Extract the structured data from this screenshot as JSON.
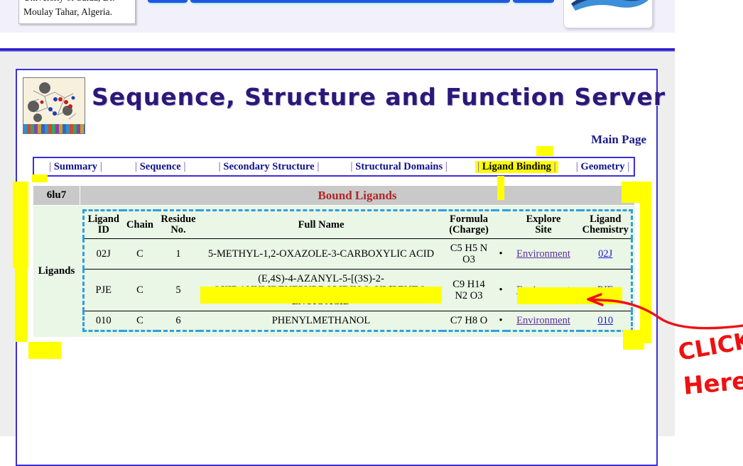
{
  "top_banner": {
    "affiliation": "University of Saida, Dr.\nMoulay Tahar, Algeria.",
    "logo_name": "institution-logo"
  },
  "header": {
    "site_title": "Sequence, Structure and Function Server",
    "main_page_label": "Main Page",
    "logo_alt": "molecular-structure-thumbnail"
  },
  "nav": {
    "items": [
      {
        "label": "Summary",
        "active": false
      },
      {
        "label": "Sequence",
        "active": false
      },
      {
        "label": "Secondary Structure",
        "active": false
      },
      {
        "label": "Structural Domains",
        "active": false
      },
      {
        "label": "Ligand Binding",
        "active": true
      },
      {
        "label": "Geometry",
        "active": false
      }
    ],
    "separator": "|"
  },
  "table": {
    "pdb_id": "6lu7",
    "section_title": "Bound Ligands",
    "row_label": "Ligands",
    "columns": [
      "Ligand ID",
      "Chain",
      "Residue No.",
      "Full Name",
      "Formula (Charge)",
      "Explore Site",
      "Ligand Chemistry"
    ],
    "columns_split": {
      "ligand_id": [
        "Ligand",
        "ID"
      ],
      "chain": [
        "Chain",
        ""
      ],
      "residue_no": [
        "Residue",
        "No."
      ],
      "full_name": [
        "Full Name",
        ""
      ],
      "formula": [
        "Formula",
        "(Charge)"
      ],
      "explore": [
        "Explore",
        "Site"
      ],
      "chemistry": [
        "Ligand",
        "Chemistry"
      ]
    },
    "rows": [
      {
        "ligand_id": "02J",
        "chain": "C",
        "residue_no": "1",
        "full_name": "5-METHYL-1,2-OXAZOLE-3-CARBOXYLIC ACID",
        "formula_line1": "C5 H5 N",
        "formula_line2": "O3",
        "bullet": "•",
        "explore_label": "Environment",
        "chemistry_label": "02J",
        "highlighted": false
      },
      {
        "ligand_id": "PJE",
        "chain": "C",
        "residue_no": "5",
        "full_name_line1": "(E,4S)-4-AZANYL-5-[(3S)-2-",
        "full_name_line2": "OXIDANYLIDENEPYRROLIDIN-3- YL]PENT-2-",
        "full_name_line3": "ENOIC ACID",
        "formula_line1": "C9 H14",
        "formula_line2": "N2 O3",
        "bullet": "•",
        "explore_label": "Environment",
        "chemistry_label": "PJE",
        "highlighted": true
      },
      {
        "ligand_id": "010",
        "chain": "C",
        "residue_no": "6",
        "full_name": "PHENYLMETHANOL",
        "formula_line1": "C7 H8 O",
        "formula_line2": "",
        "bullet": "•",
        "explore_label": "Environment",
        "chemistry_label": "010",
        "highlighted": false
      }
    ]
  },
  "annotations": {
    "click_here_line1": "CLICK",
    "click_here_line2": "Here",
    "arrow_color": "#ee1111",
    "highlighter_color": "#ffff00"
  },
  "colors": {
    "frame_border": "#3b2fd8",
    "title_purple": "#2b1878",
    "section_red": "#b02626",
    "table_green": "#eaf6e6",
    "header_grey": "#c9c9c9",
    "dashed_blue": "#2e9fe0",
    "link_purple": "#4a3fb0",
    "link_blue": "#1a1ad0"
  }
}
